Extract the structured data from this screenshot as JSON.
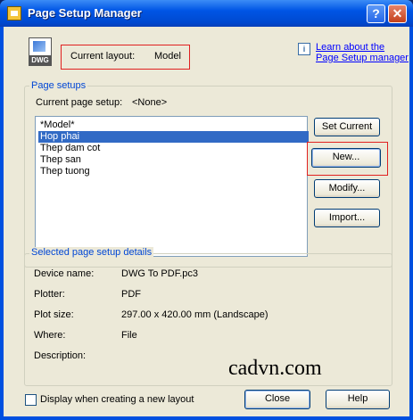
{
  "window": {
    "title": "Page Setup Manager",
    "help_button": "?",
    "close_button": "✕"
  },
  "header": {
    "icon_label": "DWG",
    "current_layout_label": "Current layout:",
    "current_layout_value": "Model",
    "learn_link_line1": "Learn about the",
    "learn_link_line2": "Page Setup manager"
  },
  "page_setups": {
    "group_label": "Page setups",
    "current_label": "Current page setup:",
    "current_value": "<None>",
    "items": [
      "*Model*",
      "Hop phai",
      "Thep dam cot",
      "Thep san",
      "Thep tuong"
    ],
    "selected_index": 1,
    "buttons": {
      "set_current": "Set Current",
      "new": "New...",
      "modify": "Modify...",
      "import": "Import..."
    }
  },
  "details": {
    "group_label": "Selected page setup details",
    "rows": [
      {
        "label": "Device name:",
        "value": "DWG To PDF.pc3"
      },
      {
        "label": "Plotter:",
        "value": "PDF"
      },
      {
        "label": "Plot size:",
        "value": "297.00 x 420.00 mm (Landscape)"
      },
      {
        "label": "Where:",
        "value": "File"
      },
      {
        "label": "Description:",
        "value": ""
      }
    ]
  },
  "watermark": "cadvn.com",
  "footer": {
    "display_checkbox_label": "Display when creating a new layout",
    "display_checked": false,
    "close_button": "Close",
    "help_button": "Help"
  }
}
